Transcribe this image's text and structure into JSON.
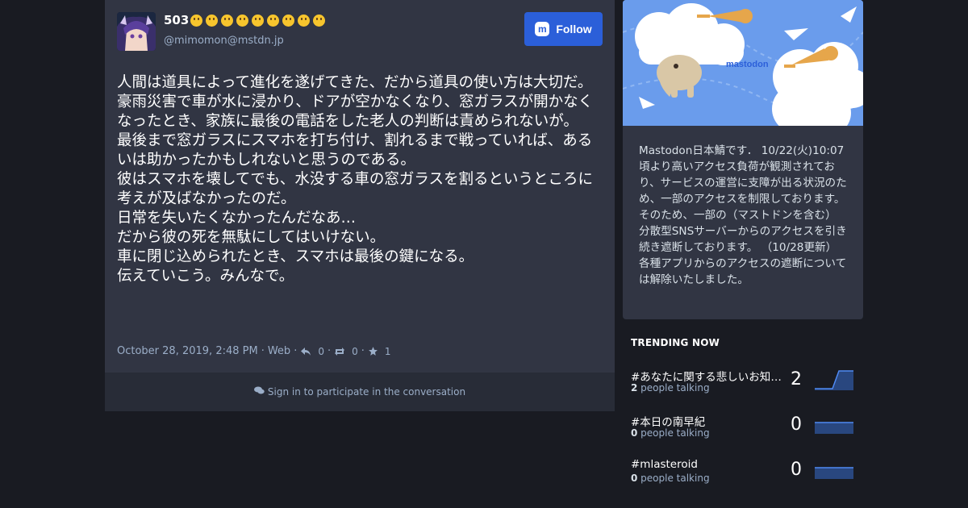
{
  "status": {
    "display_name": "503",
    "emoji_icons": [
      "zipper-mouth-face-icon",
      "pleading-face-icon",
      "rolling-eyes-face-icon",
      "worried-face-icon",
      "thinking-face-icon",
      "grinning-face-icon",
      "hugging-face-icon",
      "winking-tongue-face-icon",
      "partying-face-icon"
    ],
    "handle": "@mimomon@mstdn.jp",
    "follow_label": "Follow",
    "content": [
      "人間は道具によって進化を遂げてきた、だから道具の使い方は大切だ。",
      "豪雨災害で車が水に浸かり、ドアが空かなくなり、窓ガラスが開かなくなったとき、家族に最後の電話をした老人の判断は責められないが。",
      "最後まで窓ガラスにスマホを打ち付け、割れるまで戦っていれば、あるいは助かったかもしれないと思うのである。",
      "彼はスマホを壊してでも、水没する車の窓ガラスを割るというところに考えが及ばなかったのだ。",
      "日常を失いたくなかったんだなあ…",
      "だから彼の死を無駄にしてはいけない。",
      "車に閉じ込められたとき、スマホは最後の鍵になる。",
      "伝えていこう。みんなで。"
    ],
    "timestamp": "October 28, 2019, 2:48 PM",
    "sep": "·",
    "client": "Web",
    "replies": "0",
    "boosts": "0",
    "favourites": "1"
  },
  "participate_label": "Sign in to participate in the conversation",
  "hero": {
    "brand": "mastodon"
  },
  "about": "Mastodon日本鯖です． 10/22(火)10:07頃より高いアクセス負荷が観測されており、サービスの運営に支障が出る状況のため、一部のアクセスを制限しております。 そのため、一部の（マストドンを含む）分散型SNSサーバーからのアクセスを引き続き遮断しております。 （10/28更新）各種アプリからのアクセスの遮断については解除いたしました。",
  "trending": {
    "title": "TRENDING NOW",
    "people_suffix": " people talking",
    "items": [
      {
        "name": "#あなたに関する悲しいお知らせ",
        "count": "2",
        "people": "2"
      },
      {
        "name": "#本日の南早紀",
        "count": "0",
        "people": "0"
      },
      {
        "name": "#mlasteroid",
        "count": "0",
        "people": "0"
      }
    ]
  },
  "colors": {
    "background": "#191b22",
    "card": "#313543",
    "accent": "#2b5fd9",
    "muted": "#9baec8"
  }
}
